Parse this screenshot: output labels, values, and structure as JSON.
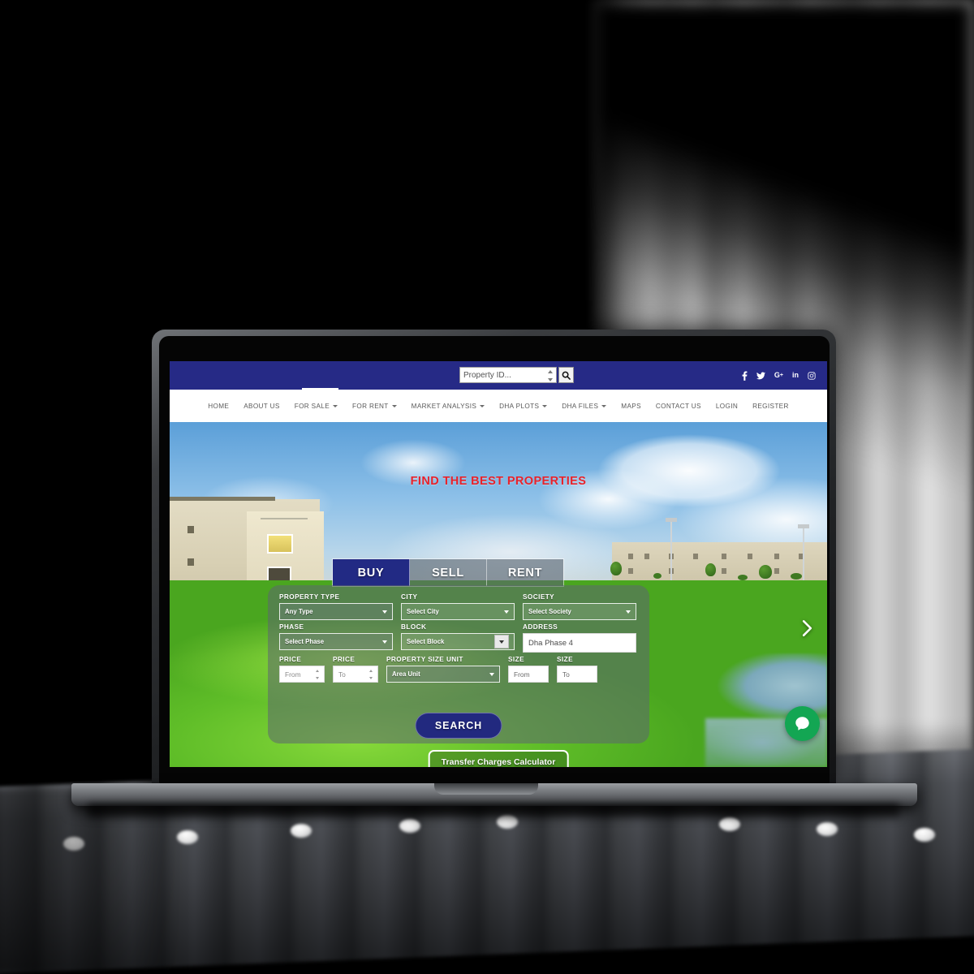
{
  "site": {
    "topbar": {
      "property_id_placeholder": "Property ID...",
      "search_icon": "search-icon",
      "socials": [
        {
          "name": "facebook-icon",
          "glyph": "f"
        },
        {
          "name": "twitter-icon",
          "glyph": "🐦"
        },
        {
          "name": "google-plus-icon",
          "glyph": "G+"
        },
        {
          "name": "linkedin-icon",
          "glyph": "in"
        },
        {
          "name": "instagram-icon",
          "glyph": "◎"
        }
      ]
    },
    "nav": [
      {
        "label": "HOME",
        "dropdown": false
      },
      {
        "label": "ABOUT US",
        "dropdown": false
      },
      {
        "label": "FOR SALE",
        "dropdown": true
      },
      {
        "label": "FOR RENT",
        "dropdown": true
      },
      {
        "label": "MARKET ANALYSIS",
        "dropdown": true
      },
      {
        "label": "DHA PLOTS",
        "dropdown": true
      },
      {
        "label": "DHA FILES",
        "dropdown": true
      },
      {
        "label": "MAPS",
        "dropdown": false
      },
      {
        "label": "CONTACT US",
        "dropdown": false
      },
      {
        "label": "LOGIN",
        "dropdown": false
      },
      {
        "label": "REGISTER",
        "dropdown": false
      }
    ],
    "hero": {
      "headline": "FIND THE BEST PROPERTIES",
      "tabs": [
        {
          "label": "BUY",
          "active": true
        },
        {
          "label": "SELL",
          "active": false
        },
        {
          "label": "RENT",
          "active": false
        }
      ],
      "form": {
        "property_type": {
          "label": "PROPERTY TYPE",
          "value": "Any Type"
        },
        "city": {
          "label": "CITY",
          "value": "Select City"
        },
        "society": {
          "label": "SOCIETY",
          "value": "Select Society"
        },
        "phase": {
          "label": "PHASE",
          "value": "Select Phase"
        },
        "block": {
          "label": "BLOCK",
          "value": "Select Block"
        },
        "address": {
          "label": "ADDRESS",
          "value": "Dha Phase 4"
        },
        "price_from": {
          "label": "PRICE",
          "placeholder": "From"
        },
        "price_to": {
          "label": "PRICE",
          "placeholder": "To"
        },
        "size_unit": {
          "label": "PROPERTY SIZE UNIT",
          "value": "Area Unit"
        },
        "size_from": {
          "label": "SIZE",
          "placeholder": "From"
        },
        "size_to": {
          "label": "SIZE",
          "placeholder": "To"
        },
        "search_button": "SEARCH"
      },
      "calculator_button": "Transfer Charges Calculator",
      "carousel_next_icon": "chevron-right-icon",
      "chat_icon": "chat-bubble-icon"
    },
    "colors": {
      "brand_navy": "#262a86",
      "headline_red": "#e8222a",
      "chat_green": "#13a653",
      "panel_overlay": "rgba(92,102,112,0.55)"
    }
  }
}
